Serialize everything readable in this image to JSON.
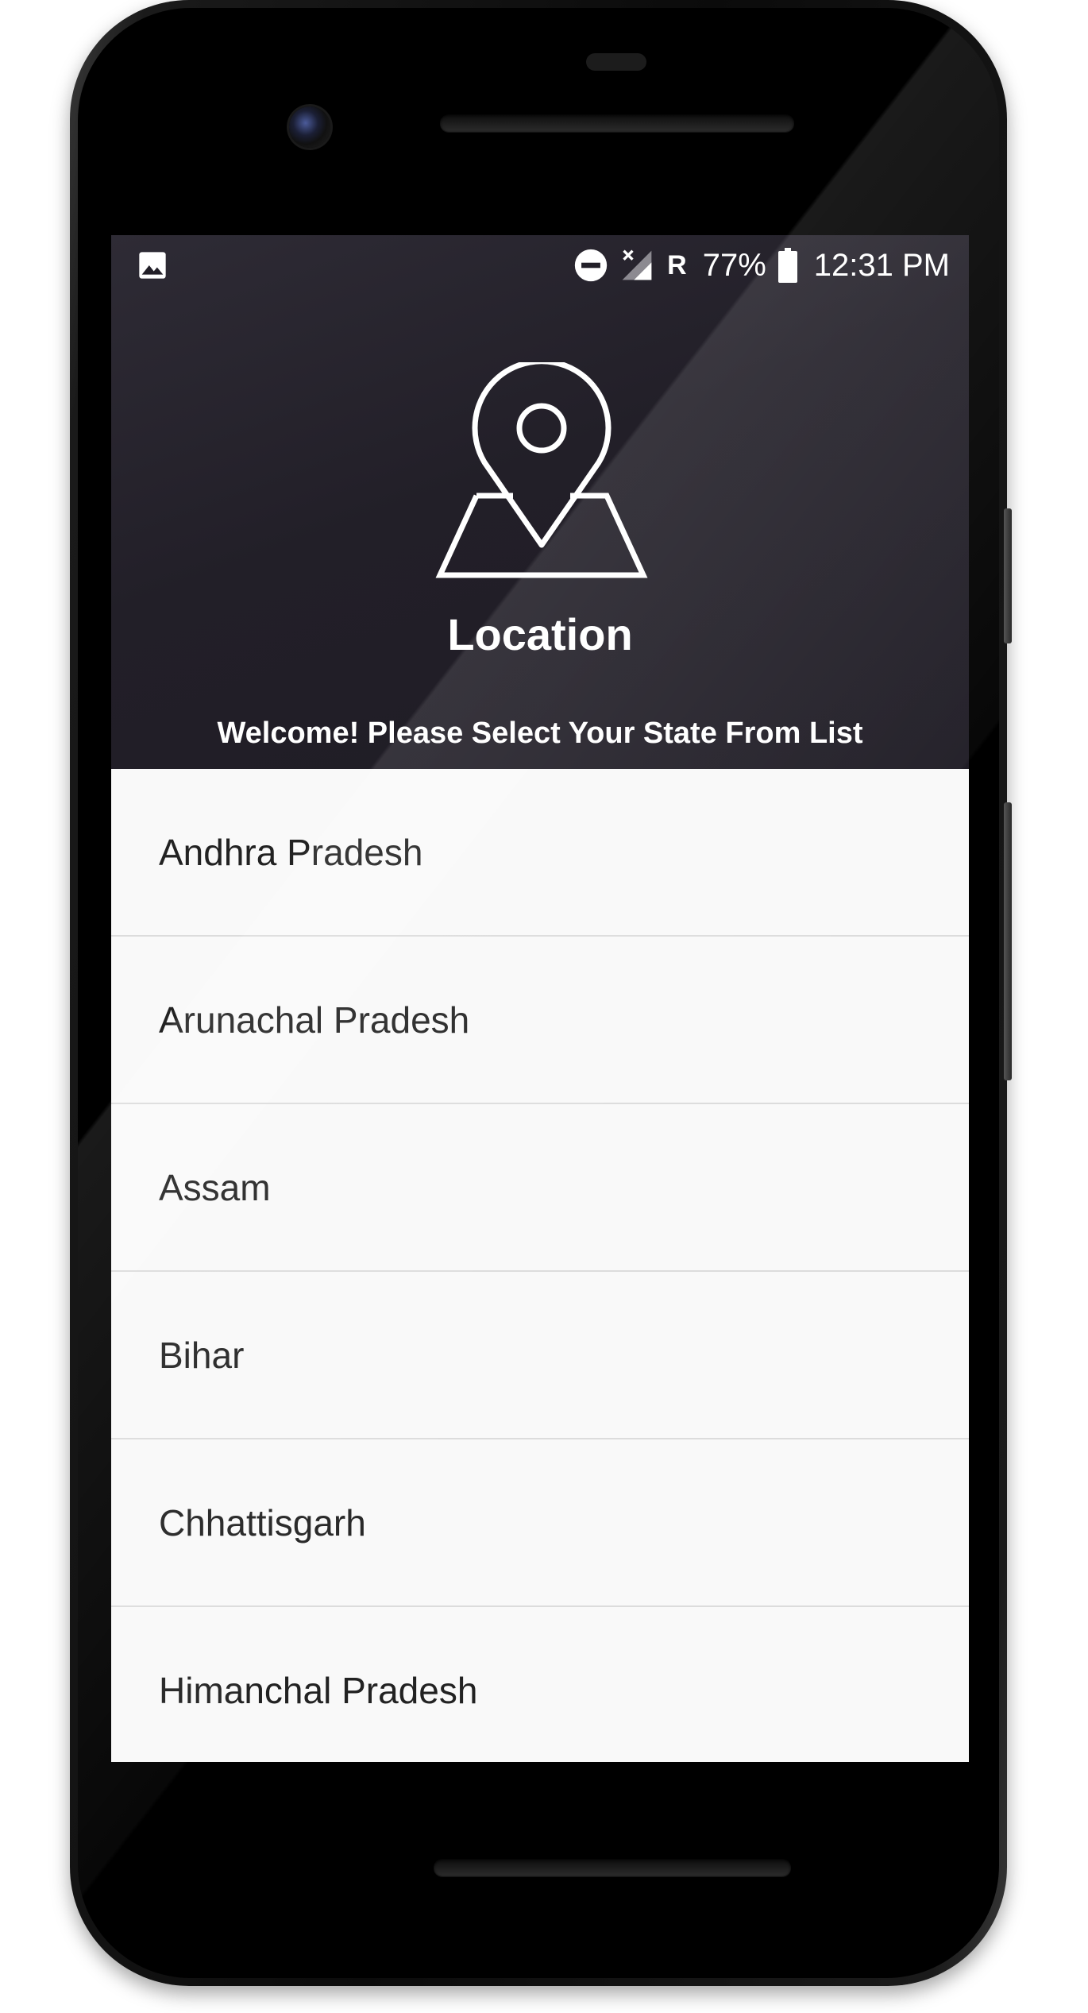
{
  "status_bar": {
    "icons": [
      "image-icon",
      "do-not-disturb-icon",
      "signal-no-data-icon",
      "battery-icon"
    ],
    "roaming": "R",
    "battery": "77%",
    "time": "12:31 PM",
    "color": "#ffffff"
  },
  "header": {
    "icon": "map-pin-icon",
    "title": "Location",
    "subtitle": "Welcome! Please Select Your State From List",
    "background": "#221f28"
  },
  "states": [
    {
      "label": "Andhra Pradesh"
    },
    {
      "label": "Arunachal Pradesh"
    },
    {
      "label": "Assam"
    },
    {
      "label": "Bihar"
    },
    {
      "label": "Chhattisgarh"
    },
    {
      "label": "Himanchal Pradesh"
    }
  ],
  "colors": {
    "list_background": "#f9f9f9",
    "divider": "#dcdcdc",
    "list_text": "#222222"
  }
}
